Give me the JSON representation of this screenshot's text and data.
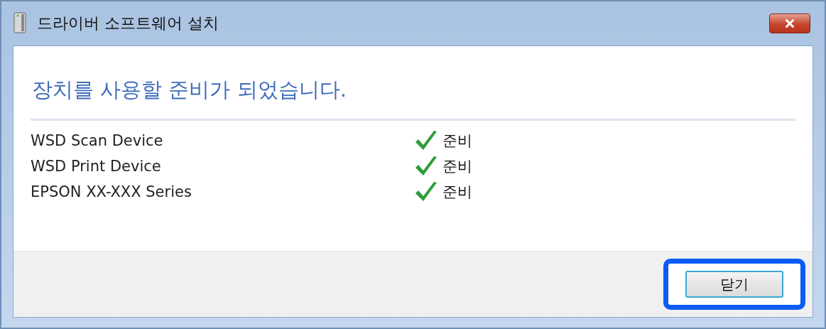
{
  "window": {
    "title": "드라이버 소프트웨어 설치"
  },
  "heading": "장치를 사용할 준비가 되었습니다.",
  "devices": [
    {
      "name": "WSD Scan Device",
      "status": "준비",
      "ready": true
    },
    {
      "name": "WSD Print Device",
      "status": "준비",
      "ready": true
    },
    {
      "name": "EPSON XX-XXX Series",
      "status": "준비",
      "ready": true
    }
  ],
  "close_button": {
    "label": "닫기",
    "highlighted": true
  }
}
